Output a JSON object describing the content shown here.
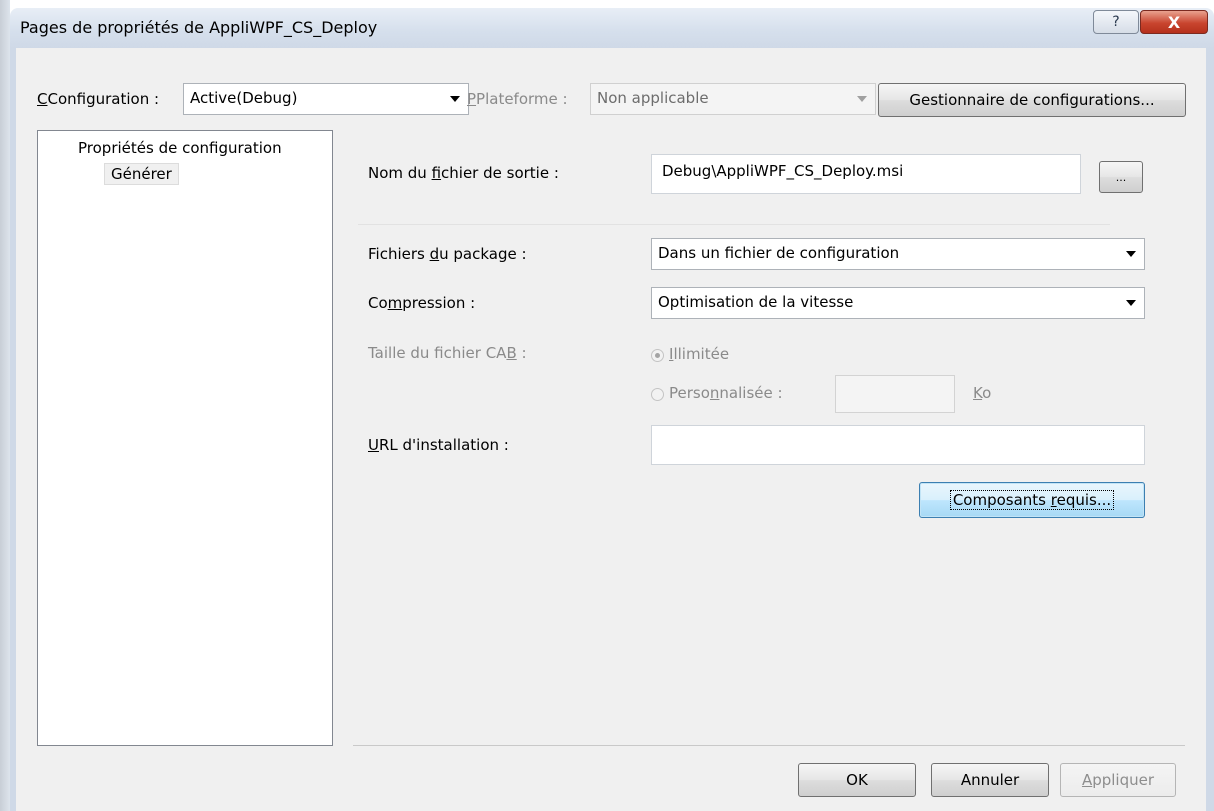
{
  "window": {
    "title": "Pages de propriétés de AppliWPF_CS_Deploy",
    "help_glyph": "?",
    "close_glyph": "X"
  },
  "toolbar": {
    "configuration_label": "Configuration :",
    "configuration_value": "Active(Debug)",
    "platform_label": "Plateforme :",
    "platform_value": "Non applicable",
    "config_manager_button": "Gestionnaire de configurations..."
  },
  "tree": {
    "root": "Propriétés de configuration",
    "child": "Générer"
  },
  "form": {
    "output_label": "Nom du fichier de sortie :",
    "output_value": "Debug\\AppliWPF_CS_Deploy.msi",
    "browse_button": "...",
    "package_files_label": "Fichiers du package :",
    "package_files_value": "Dans un fichier de configuration",
    "compression_label": "Compression :",
    "compression_value": "Optimisation de la vitesse",
    "cab_size_label": "Taille du fichier CAB :",
    "unlimited_label": "Illimitée",
    "custom_label": "Personnalisée :",
    "custom_unit": "Ko",
    "install_url_label": "URL d'installation :",
    "install_url_value": "",
    "prerequisites_button": "Composants requis..."
  },
  "footer": {
    "ok": "OK",
    "cancel": "Annuler",
    "apply": "Appliquer"
  },
  "colors": {
    "close_button": "#c9452f",
    "focus_button": "#bee6fd",
    "dialog_background": "#f0f0f0"
  }
}
